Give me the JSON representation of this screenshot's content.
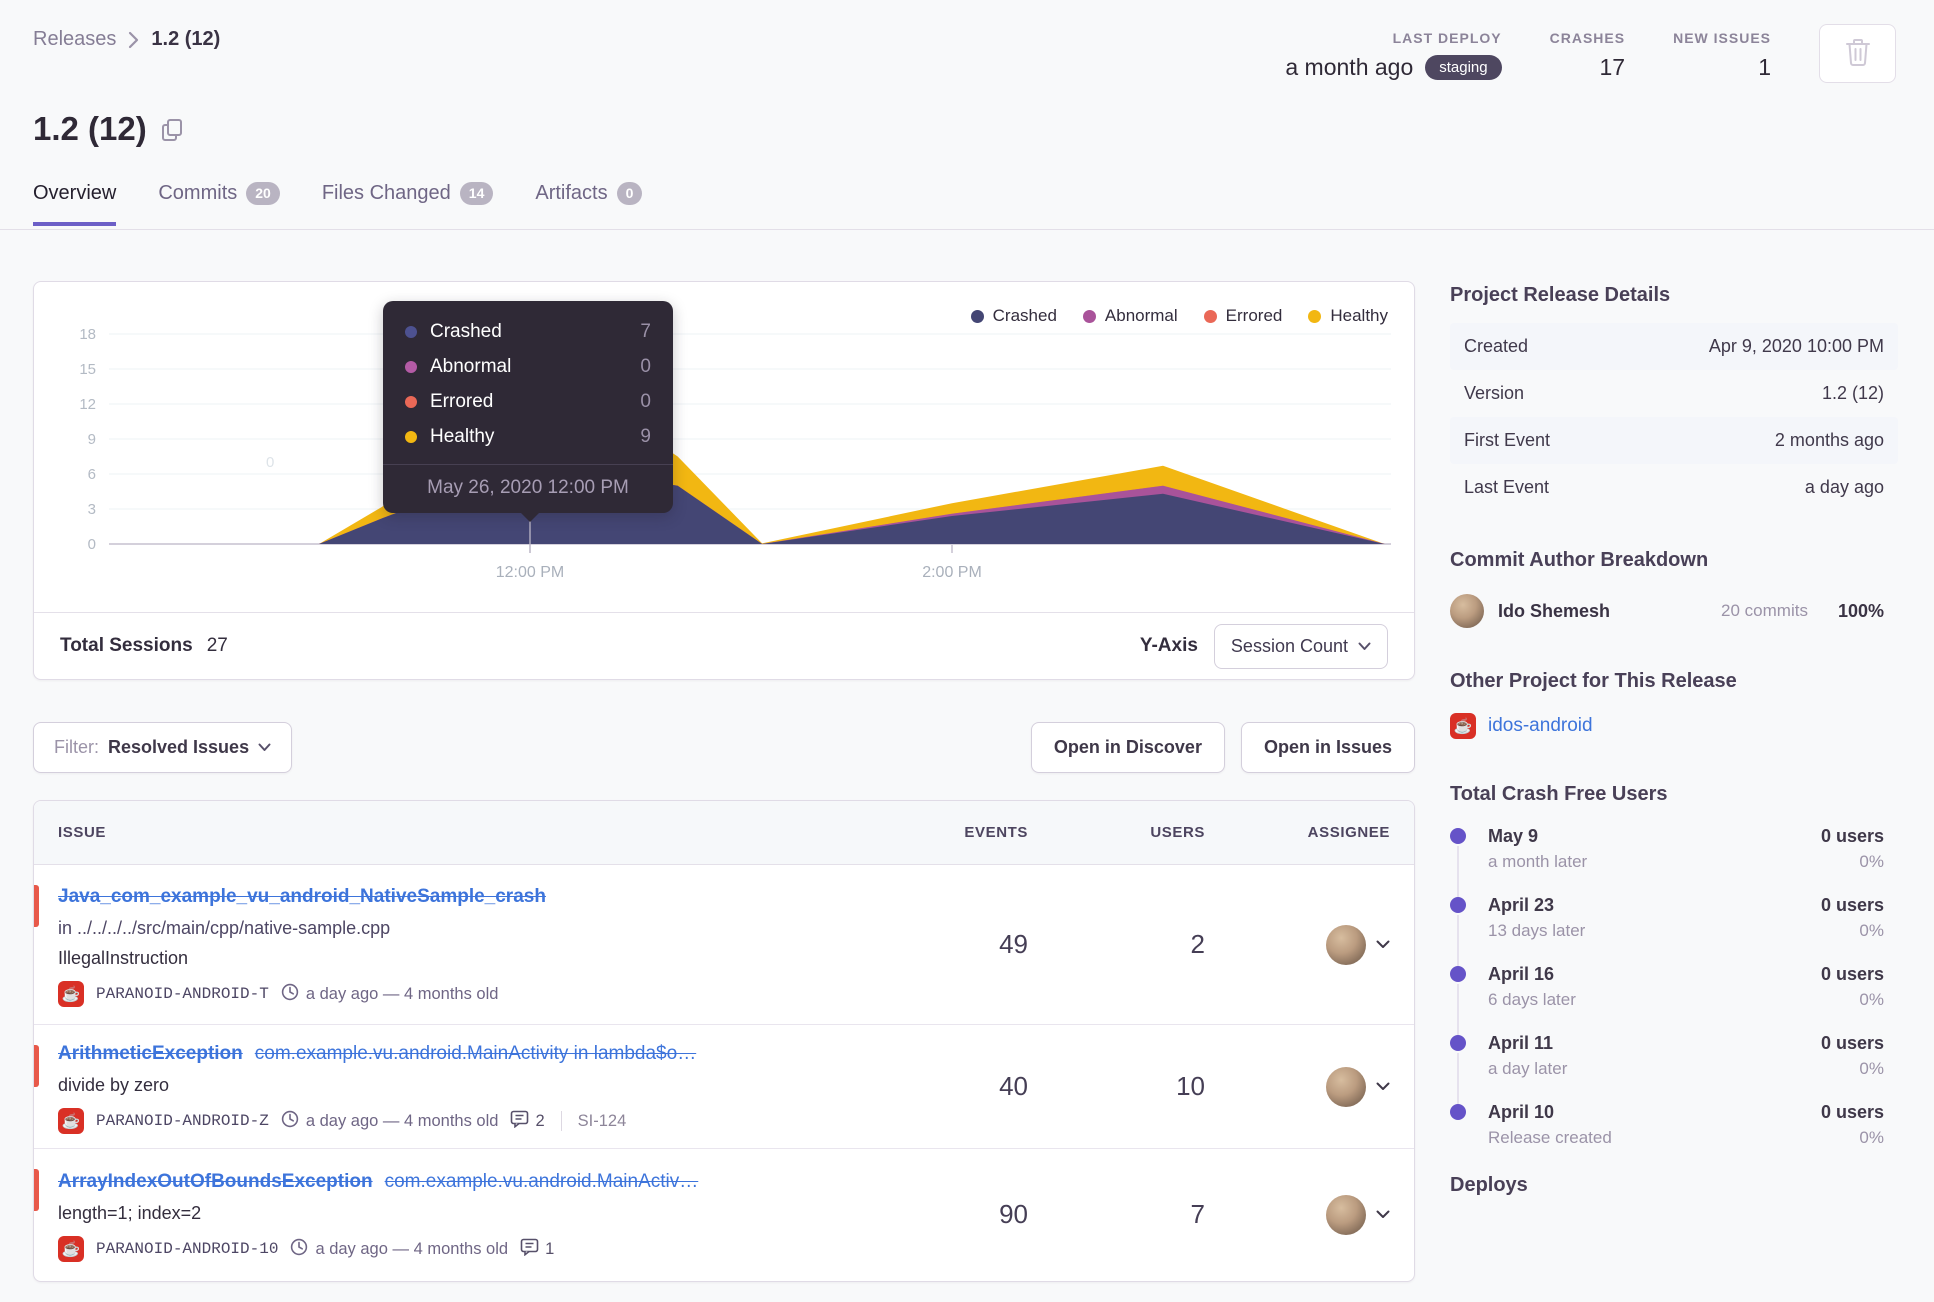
{
  "breadcrumb": {
    "root": "Releases",
    "current": "1.2 (12)"
  },
  "header_stats": {
    "last_deploy": {
      "label": "LAST DEPLOY",
      "value": "a month ago",
      "env_badge": "staging"
    },
    "crashes": {
      "label": "CRASHES",
      "value": "17"
    },
    "new_issues": {
      "label": "NEW ISSUES",
      "value": "1"
    }
  },
  "title": "1.2 (12)",
  "tabs": [
    {
      "label": "Overview",
      "active": true
    },
    {
      "label": "Commits",
      "badge": "20"
    },
    {
      "label": "Files Changed",
      "badge": "14"
    },
    {
      "label": "Artifacts",
      "badge": "0"
    }
  ],
  "chart_card": {
    "legend": [
      {
        "label": "Crashed",
        "color": "#444674"
      },
      {
        "label": "Abnormal",
        "color": "#a9539a"
      },
      {
        "label": "Errored",
        "color": "#ea6857"
      },
      {
        "label": "Healthy",
        "color": "#f2b712"
      }
    ],
    "tooltip": {
      "rows": [
        {
          "label": "Crashed",
          "value": "7",
          "color": "#4d5190"
        },
        {
          "label": "Abnormal",
          "value": "0",
          "color": "#b45ba6"
        },
        {
          "label": "Errored",
          "value": "0",
          "color": "#ea6857"
        },
        {
          "label": "Healthy",
          "value": "9",
          "color": "#f2b712"
        }
      ],
      "footer": "May 26, 2020 12:00 PM"
    },
    "faint_marker": "0",
    "footer": {
      "total_label": "Total Sessions",
      "total_value": "27",
      "yaxis_label": "Y-Axis",
      "yaxis_button": "Session Count"
    }
  },
  "chart_data": {
    "type": "area",
    "stacked": true,
    "x_hours": [
      10.0,
      11.0,
      11.3,
      12.0,
      12.7,
      13.1,
      14.0,
      15.0,
      16.05
    ],
    "series": [
      {
        "name": "Crashed",
        "color": "#444674",
        "values": [
          0,
          0,
          2.2,
          7,
          5,
          0,
          2.4,
          4.3,
          0
        ]
      },
      {
        "name": "Abnormal",
        "color": "#a9539a",
        "values": [
          0,
          0,
          0,
          0,
          0,
          0,
          0.2,
          0.7,
          0
        ]
      },
      {
        "name": "Errored",
        "color": "#ea6857",
        "values": [
          0,
          0,
          0,
          0,
          0,
          0,
          0,
          0,
          0
        ]
      },
      {
        "name": "Healthy",
        "color": "#f2b712",
        "values": [
          0,
          0,
          1,
          9,
          2.5,
          0.05,
          0.9,
          1.7,
          0
        ]
      }
    ],
    "ylim": [
      0,
      18
    ],
    "y_ticks": [
      18,
      15,
      12,
      9,
      6,
      3,
      0
    ],
    "x_axis_ticks": [
      {
        "label": "12:00 PM",
        "hour": 12
      },
      {
        "label": "2:00 PM",
        "hour": 14
      }
    ],
    "highlighted_point": {
      "time": "May 26, 2020 12:00 PM",
      "Crashed": 7,
      "Abnormal": 0,
      "Errored": 0,
      "Healthy": 9
    },
    "total_sessions": 27,
    "legend_position": "top-right",
    "grid": true
  },
  "toolbar": {
    "filter_label": "Filter:",
    "filter_value": "Resolved Issues",
    "open_discover": "Open in Discover",
    "open_issues": "Open in Issues"
  },
  "issues_table": {
    "columns": [
      "ISSUE",
      "EVENTS",
      "USERS",
      "ASSIGNEE"
    ],
    "rows": [
      {
        "title": "Java_com_example_vu_android_NativeSample_crash",
        "location": "in ../../../../src/main/cpp/native-sample.cpp",
        "subtitle": "IllegalInstruction",
        "project": "PARANOID-ANDROID-T",
        "age": "a day ago — 4 months old",
        "events": "49",
        "users": "2"
      },
      {
        "title": "ArithmeticException",
        "culprit": "com.example.vu.android.MainActivity in lambda$o…",
        "subtitle": "divide by zero",
        "project": "PARANOID-ANDROID-Z",
        "age": "a day ago — 4 months old",
        "comments": "2",
        "short_id": "SI-124",
        "events": "40",
        "users": "10"
      },
      {
        "title": "ArrayIndexOutOfBoundsException",
        "culprit": "com.example.vu.android.MainActiv…",
        "subtitle": "length=1; index=2",
        "project": "PARANOID-ANDROID-10",
        "age": "a day ago — 4 months old",
        "comments": "1",
        "events": "90",
        "users": "7"
      }
    ]
  },
  "sidebar": {
    "details_heading": "Project Release Details",
    "details": [
      {
        "label": "Created",
        "value": "Apr 9, 2020 10:00 PM",
        "striped": true
      },
      {
        "label": "Version",
        "value": "1.2 (12)",
        "striped": false
      },
      {
        "label": "First Event",
        "value": "2 months ago",
        "striped": true
      },
      {
        "label": "Last Event",
        "value": "a day ago",
        "striped": false
      }
    ],
    "authors_heading": "Commit Author Breakdown",
    "author": {
      "name": "Ido Shemesh",
      "commits": "20 commits",
      "pct": "100%"
    },
    "other_project_heading": "Other Project for This Release",
    "other_project": "idos-android",
    "crash_free_heading": "Total Crash Free Users",
    "timeline": [
      {
        "date": "May 9",
        "note": "a month later",
        "users": "0 users",
        "pct": "0%"
      },
      {
        "date": "April 23",
        "note": "13 days later",
        "users": "0 users",
        "pct": "0%"
      },
      {
        "date": "April 16",
        "note": "6 days later",
        "users": "0 users",
        "pct": "0%"
      },
      {
        "date": "April 11",
        "note": "a day later",
        "users": "0 users",
        "pct": "0%"
      },
      {
        "date": "April 10",
        "note": "Release created",
        "users": "0 users",
        "pct": "0%"
      }
    ],
    "deploys_heading": "Deploys"
  }
}
